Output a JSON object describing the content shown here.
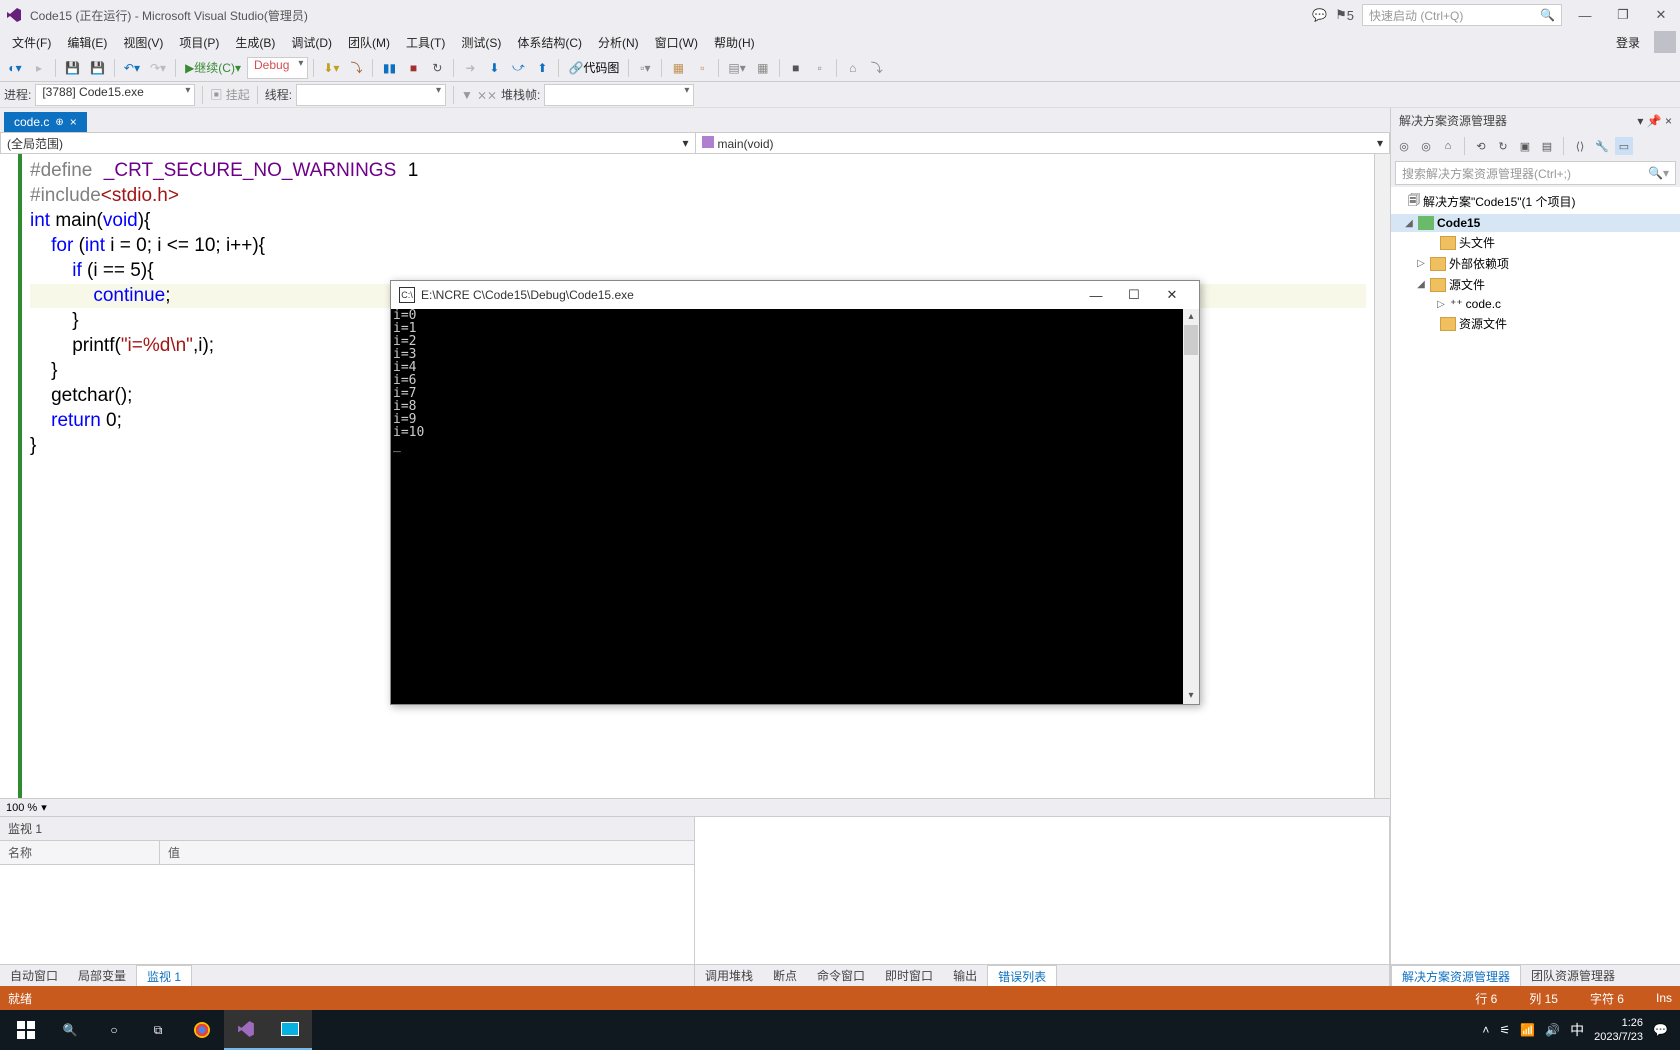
{
  "title": {
    "text": "Code15 (正在运行) - Microsoft Visual Studio(管理员)",
    "flag_badge": "5",
    "quick_launch_placeholder": "快速启动 (Ctrl+Q)"
  },
  "menu": {
    "items": [
      "文件(F)",
      "编辑(E)",
      "视图(V)",
      "项目(P)",
      "生成(B)",
      "调试(D)",
      "团队(M)",
      "工具(T)",
      "测试(S)",
      "体系结构(C)",
      "分析(N)",
      "窗口(W)",
      "帮助(H)"
    ],
    "login": "登录"
  },
  "toolbar": {
    "continue_label": "继续(C)",
    "debug_label": "Debug",
    "codemap_label": "代码图"
  },
  "procbar": {
    "process_label": "进程:",
    "process_value": "[3788] Code15.exe",
    "suspend_label": "挂起",
    "thread_label": "线程:",
    "stackframe_label": "堆栈帧:"
  },
  "tabs": {
    "file_tab": "code.c"
  },
  "nav": {
    "scope": "(全局范围)",
    "member": "main(void)"
  },
  "editor": {
    "zoom": "100 %",
    "code_tokens": {
      "l1_dir": "#define",
      "l1_mac": "_CRT_SECURE_NO_WARNINGS",
      "l1_val": "1",
      "l2_dir": "#include",
      "l2_inc": "<stdio.h>",
      "l3_int": "int",
      "l3_main": " main(",
      "l3_void": "void",
      "l3_end": "){",
      "l4_a": "    ",
      "l4_for": "for",
      "l4_b": " (",
      "l4_int": "int",
      "l4_c": " i = 0; i <= 10; i++){",
      "l5_a": "        ",
      "l5_if": "if",
      "l5_b": " (i == 5){",
      "l6_a": "            ",
      "l6_cont": "continue",
      "l6_b": ";",
      "l7": "        }",
      "l8_a": "        printf(",
      "l8_str": "\"i=%d\\n\"",
      "l8_b": ",i);",
      "l9": "    }",
      "l10": "    getchar();",
      "l11_a": "    ",
      "l11_ret": "return",
      "l11_b": " 0;",
      "l12": "}"
    }
  },
  "watch": {
    "panel_title": "监视 1",
    "col_name": "名称",
    "col_value": "值"
  },
  "bottom_tabs_left": [
    "自动窗口",
    "局部变量",
    "监视 1"
  ],
  "bottom_tabs_right": [
    "调用堆栈",
    "断点",
    "命令窗口",
    "即时窗口",
    "输出",
    "错误列表"
  ],
  "solution_explorer": {
    "title": "解决方案资源管理器",
    "search_placeholder": "搜索解决方案资源管理器(Ctrl+;)",
    "root": "解决方案\"Code15\"(1 个项目)",
    "project": "Code15",
    "folders": {
      "headers": "头文件",
      "external": "外部依赖项",
      "source": "源文件",
      "resource": "资源文件"
    },
    "source_file": "code.c"
  },
  "right_tabs": [
    "解决方案资源管理器",
    "团队资源管理器"
  ],
  "status": {
    "state": "就绪",
    "line": "行 6",
    "col": "列 15",
    "char": "字符 6",
    "ins": "Ins"
  },
  "console": {
    "title": "E:\\NCRE C\\Code15\\Debug\\Code15.exe",
    "output": "i=0\ni=1\ni=2\ni=3\ni=4\ni=6\ni=7\ni=8\ni=9\ni=10\n_"
  },
  "taskbar": {
    "ime": "中",
    "time": "1:26",
    "date": "2023/7/23"
  }
}
